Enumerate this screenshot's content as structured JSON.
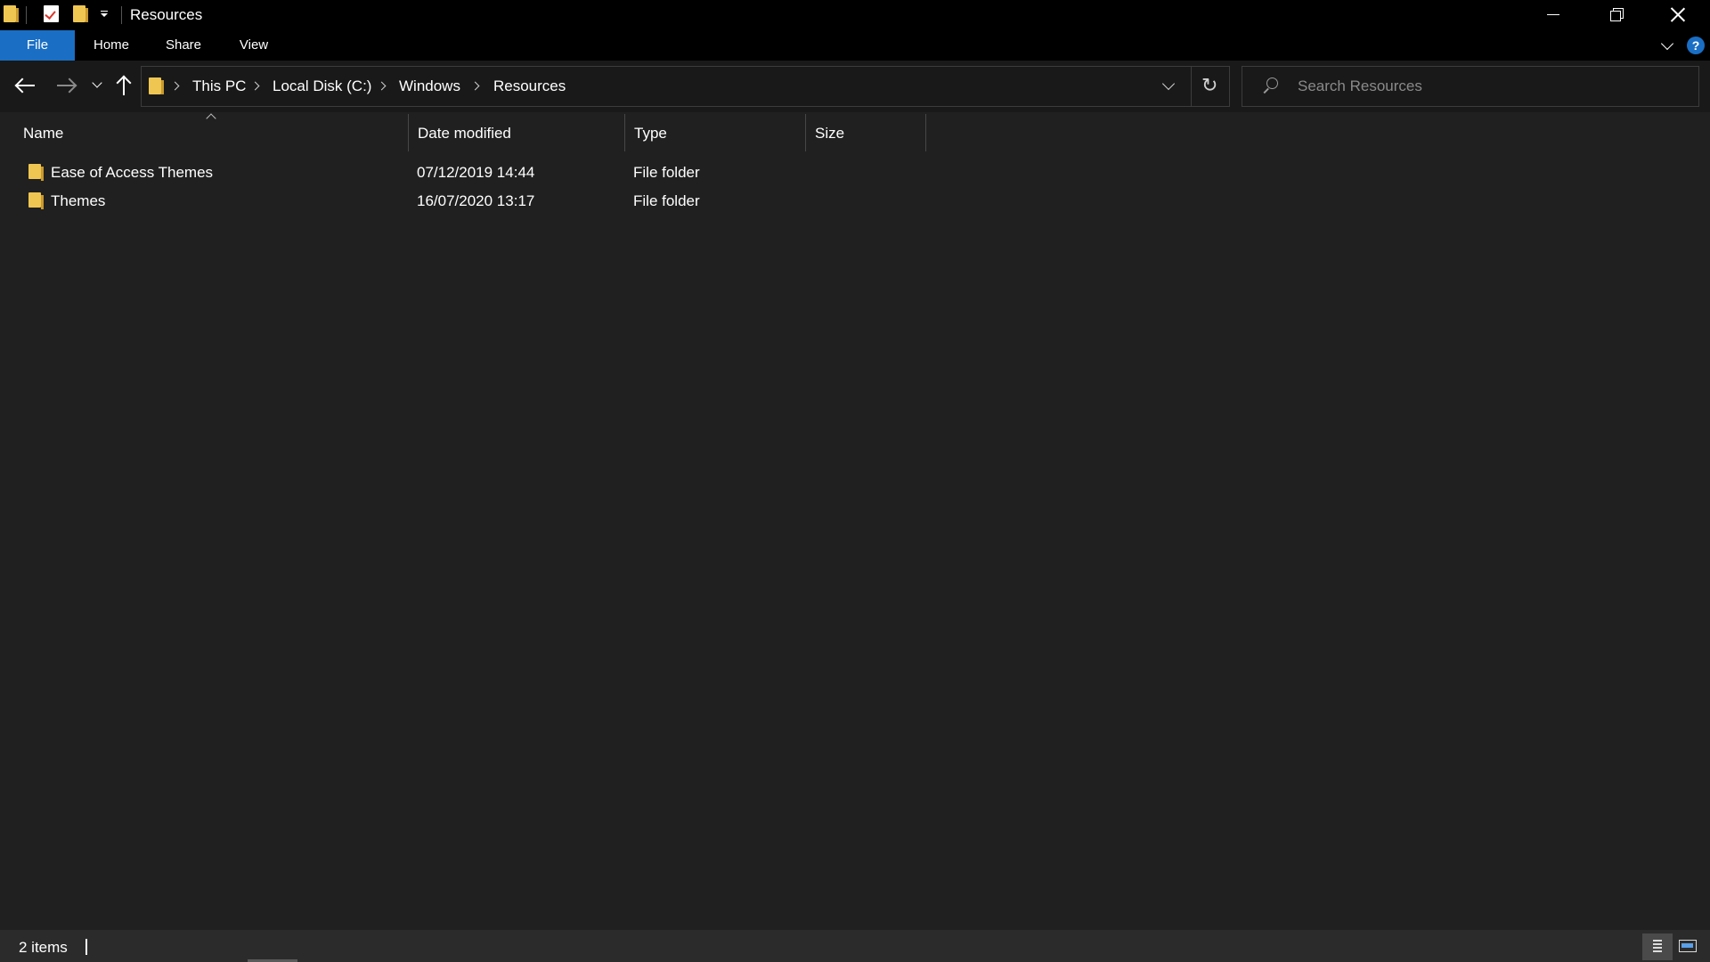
{
  "window": {
    "title": "Resources",
    "controls": [
      "minimize",
      "restore",
      "close"
    ]
  },
  "quick_access_toolbar": {
    "icons": [
      "folder-icon",
      "properties-icon",
      "new-folder-icon",
      "customize-dropdown-icon"
    ]
  },
  "ribbon": {
    "tabs": [
      {
        "label": "File",
        "active": true
      },
      {
        "label": "Home"
      },
      {
        "label": "Share"
      },
      {
        "label": "View"
      }
    ],
    "accent_color": "#1a6ec4",
    "help_label": "?"
  },
  "navigation": {
    "breadcrumbs": [
      "This PC",
      "Local Disk (C:)",
      "Windows",
      "Resources"
    ],
    "search": {
      "placeholder": "Search Resources",
      "value": ""
    }
  },
  "file_list": {
    "columns": [
      "Name",
      "Date modified",
      "Type",
      "Size"
    ],
    "sorted_by": "Name",
    "rows": [
      {
        "name": "Ease of Access Themes",
        "date_modified": "07/12/2019 14:44",
        "type": "File folder",
        "size": ""
      },
      {
        "name": "Themes",
        "date_modified": "16/07/2020 13:17",
        "type": "File folder",
        "size": ""
      }
    ]
  },
  "status_bar": {
    "item_count": "2 items"
  },
  "colors": {
    "background": "#202020",
    "chrome": "#000000",
    "folder": "#f0c653"
  }
}
